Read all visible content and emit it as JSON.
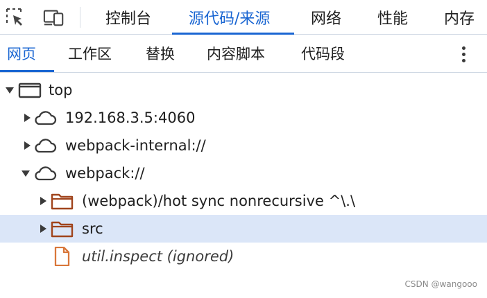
{
  "toolbar": {
    "inspect_icon": "inspect-element-icon",
    "device_icon": "device-toolbar-icon"
  },
  "main_tabs": [
    {
      "label": "控制台",
      "active": false
    },
    {
      "label": "源代码/来源",
      "active": true
    },
    {
      "label": "网络",
      "active": false
    },
    {
      "label": "性能",
      "active": false
    },
    {
      "label": "内存",
      "active": false
    }
  ],
  "sub_tabs": [
    {
      "label": "网页",
      "active": true
    },
    {
      "label": "工作区",
      "active": false
    },
    {
      "label": "替换",
      "active": false
    },
    {
      "label": "内容脚本",
      "active": false
    },
    {
      "label": "代码段",
      "active": false
    }
  ],
  "more_icon": "more-options-icon",
  "tree": [
    {
      "label": "top",
      "icon": "frame-icon",
      "expanded": true,
      "depth": 0
    },
    {
      "label": "192.168.3.5:4060",
      "icon": "cloud-icon",
      "expanded": false,
      "depth": 1
    },
    {
      "label": "webpack-internal://",
      "icon": "cloud-icon",
      "expanded": false,
      "depth": 1
    },
    {
      "label": "webpack://",
      "icon": "cloud-icon",
      "expanded": true,
      "depth": 1
    },
    {
      "label": "(webpack)/hot sync nonrecursive ^\\.\\",
      "icon": "folder-icon",
      "expanded": false,
      "depth": 2
    },
    {
      "label": "src",
      "icon": "folder-icon",
      "expanded": false,
      "depth": 2,
      "selected": true
    },
    {
      "label": "util.inspect (ignored)",
      "icon": "file-icon",
      "depth": 2,
      "ignored": true
    }
  ],
  "colors": {
    "accent": "#1a66d2",
    "selected_row": "#dbe6f8",
    "folder": "#a0441c",
    "file": "#d9773a"
  },
  "watermark": "CSDN @wangooo"
}
